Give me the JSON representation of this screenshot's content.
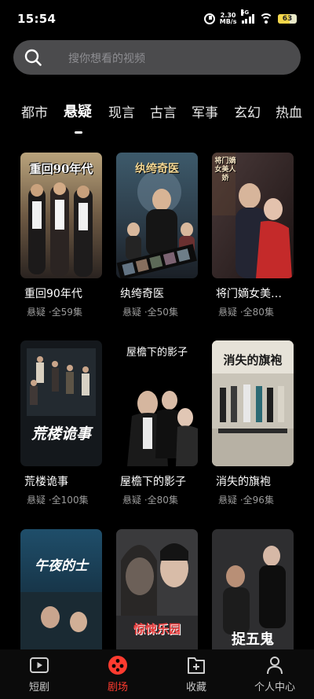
{
  "status": {
    "time": "15:54",
    "net_speed_value": "2.30",
    "net_speed_unit": "MB/s",
    "signal_label": "5G",
    "battery": "63",
    "battery_level": 0.63
  },
  "search": {
    "placeholder": "搜你想看的视频"
  },
  "categories": [
    "都市",
    "悬疑",
    "现言",
    "古言",
    "军事",
    "玄幻",
    "热血"
  ],
  "active_category": "悬疑",
  "cards": [
    {
      "title": "重回90年代",
      "genre": "悬疑",
      "episodes": "全59集",
      "poster_text": "重回90年代"
    },
    {
      "title": "纨绔奇医",
      "genre": "悬疑",
      "episodes": "全50集",
      "poster_text": "纨绔奇医"
    },
    {
      "title": "将门嫡女美…",
      "genre": "悬疑",
      "episodes": "全80集",
      "poster_text": "将门嫡女美人娇"
    },
    {
      "title": "荒楼诡事",
      "genre": "悬疑",
      "episodes": "全100集",
      "poster_text": "荒楼诡事"
    },
    {
      "title": "屋檐下的影子",
      "genre": "悬疑",
      "episodes": "全80集",
      "poster_text": "屋檐下的影子"
    },
    {
      "title": "消失的旗袍",
      "genre": "悬疑",
      "episodes": "全96集",
      "poster_text": "消失的旗袍"
    },
    {
      "title": "",
      "genre": "",
      "episodes": "",
      "poster_text": "午夜的士"
    },
    {
      "title": "",
      "genre": "",
      "episodes": "",
      "poster_text": "惊悚乐园"
    },
    {
      "title": "",
      "genre": "",
      "episodes": "",
      "poster_text": "捉五鬼"
    }
  ],
  "meta_separator": "·",
  "nav": {
    "items": [
      {
        "label": "短剧",
        "icon": "play-square-icon",
        "active": false
      },
      {
        "label": "剧场",
        "icon": "film-reel-icon",
        "active": true
      },
      {
        "label": "收藏",
        "icon": "collect-plus-icon",
        "active": false
      },
      {
        "label": "个人中心",
        "icon": "person-icon",
        "active": false
      }
    ]
  },
  "colors": {
    "accent": "#ff3b2f",
    "background": "#000000",
    "search_bg": "#4b4b4d"
  }
}
